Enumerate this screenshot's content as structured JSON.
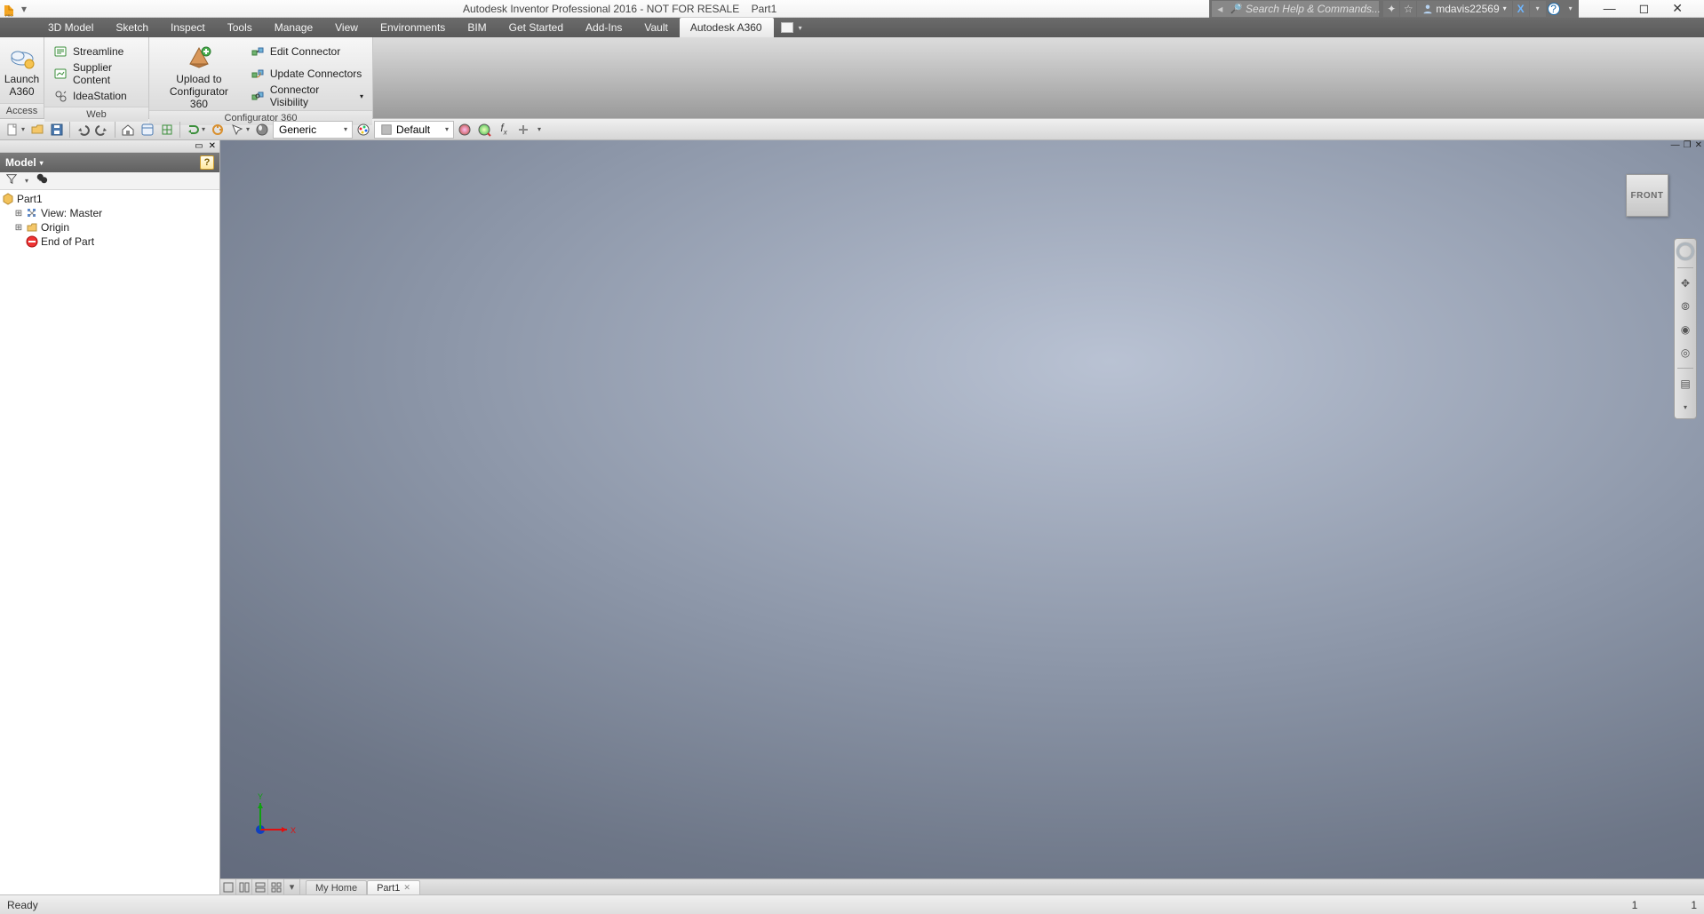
{
  "title": {
    "app": "Autodesk Inventor Professional 2016 - NOT FOR RESALE",
    "doc": "Part1"
  },
  "search": {
    "placeholder": "Search Help & Commands..."
  },
  "user": {
    "name": "mdavis22569"
  },
  "ribbon": {
    "tabs": [
      "3D Model",
      "Sketch",
      "Inspect",
      "Tools",
      "Manage",
      "View",
      "Environments",
      "BIM",
      "Get Started",
      "Add-Ins",
      "Vault",
      "Autodesk A360"
    ],
    "active_index": 11,
    "panels": {
      "access": {
        "label": "Access",
        "launch_line1": "Launch",
        "launch_line2": "A360"
      },
      "web": {
        "label": "Web",
        "items": [
          "Streamline",
          "Supplier Content",
          "IdeaStation"
        ]
      },
      "config": {
        "label": "Configurator 360",
        "upload_line1": "Upload to",
        "upload_line2": "Configurator 360",
        "items": [
          "Edit Connector",
          "Update Connectors",
          "Connector Visibility"
        ]
      }
    }
  },
  "quickbar": {
    "material_combo": "Generic",
    "appearance_combo": "Default"
  },
  "browser": {
    "title": "Model",
    "root": "Part1",
    "view": "View: Master",
    "origin": "Origin",
    "eop": "End of Part"
  },
  "viewcube": {
    "face": "FRONT"
  },
  "triad": {
    "x": "X",
    "y": "Y"
  },
  "doc_tabs": {
    "home": "My Home",
    "part": "Part1"
  },
  "status": {
    "left": "Ready",
    "r1": "1",
    "r2": "1"
  },
  "colors": {
    "accent": "#5a5a5a"
  }
}
